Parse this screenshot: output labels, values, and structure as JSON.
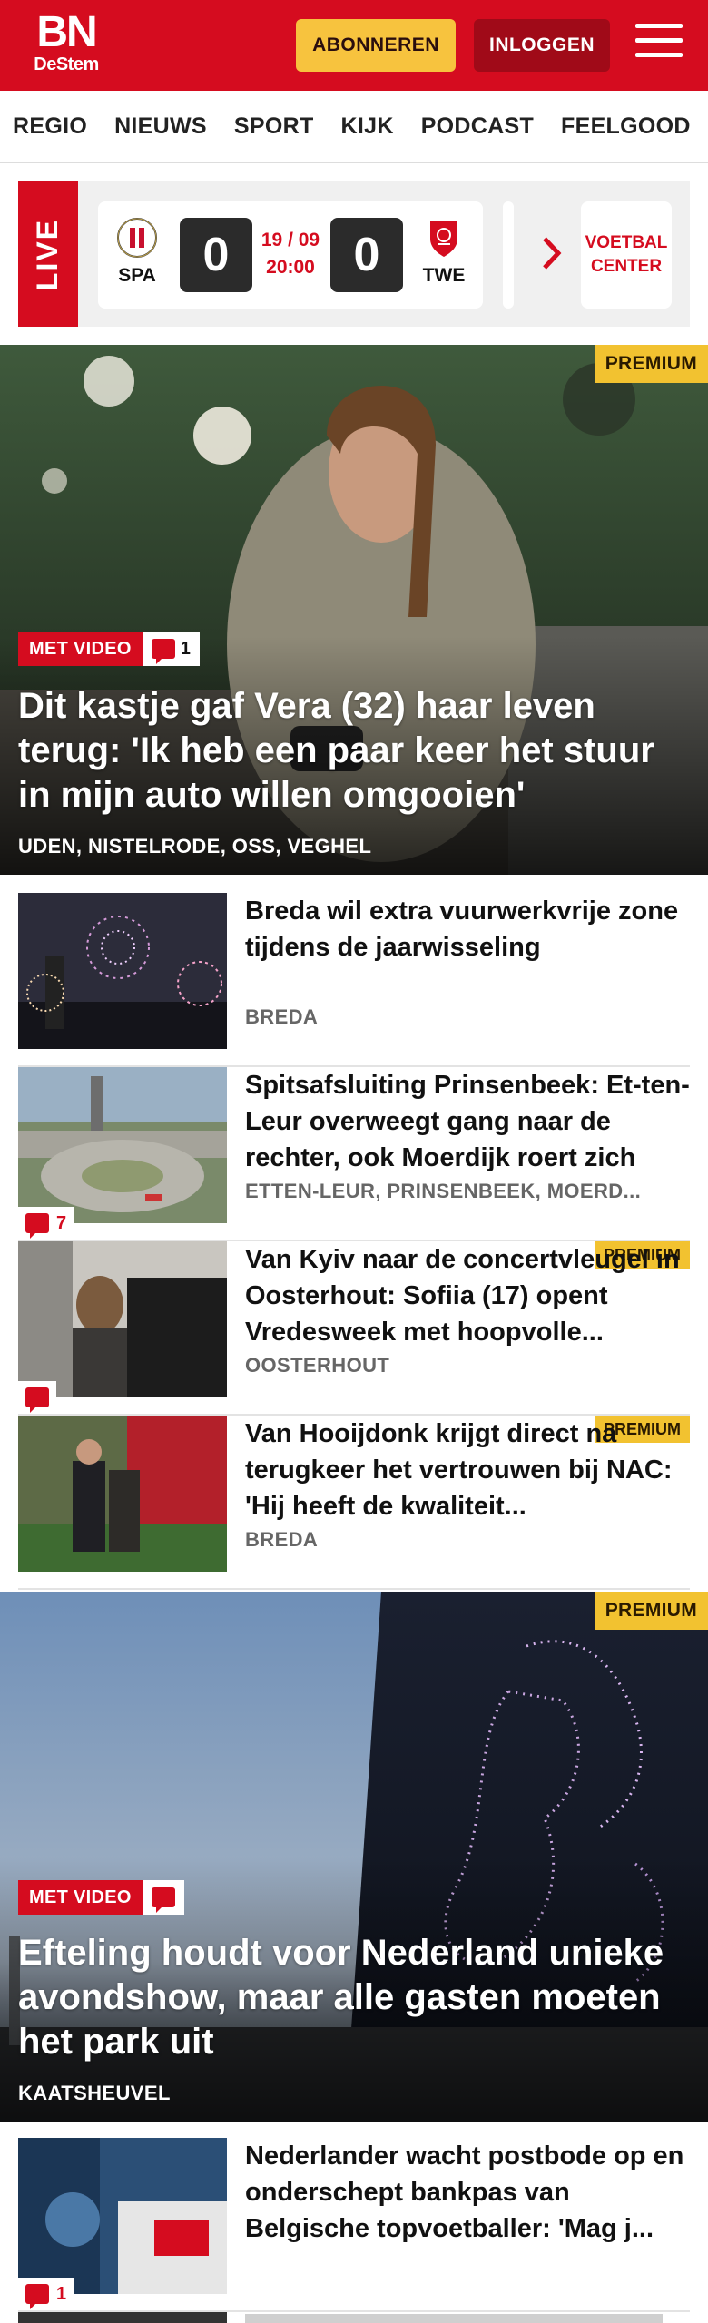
{
  "header": {
    "logo_top": "BN",
    "logo_bottom": "DeStem",
    "subscribe_label": "ABONNEREN",
    "login_label": "INLOGGEN"
  },
  "nav": {
    "items": [
      "REGIO",
      "NIEUWS",
      "SPORT",
      "KIJK",
      "PODCAST",
      "FEELGOOD"
    ]
  },
  "live": {
    "label": "LIVE",
    "match": {
      "home": "SPA",
      "away": "TWE",
      "home_score": "0",
      "away_score": "0",
      "date": "19 / 09",
      "time": "20:00"
    },
    "voetbal_center": "VOETBAL CENTER"
  },
  "hero1": {
    "premium": "PREMIUM",
    "video_label": "MET VIDEO",
    "comments": "1",
    "title": "Dit kastje gaf Vera (32) haar leven terug: 'Ik heb een paar keer het stuur in mijn auto willen omgooien'",
    "location": "UDEN, NISTELRODE, OSS, VEGHEL"
  },
  "articles": [
    {
      "title": "Breda wil extra vuurwerkvrije zone tijdens de jaarwisseling",
      "location": "BREDA",
      "comments": "",
      "premium": ""
    },
    {
      "title": "Spitsafsluiting Prinsenbeek: Et-ten-Leur overweegt gang naar de rechter, ook Moerdijk roert zich",
      "location": "ETTEN-LEUR, PRINSENBEEK, MOERD...",
      "comments": "7",
      "premium": ""
    },
    {
      "title": "Van Kyiv naar de concertvleugel in Oosterhout: Sofiia (17) opent Vredesweek met hoopvolle...",
      "location": "OOSTERHOUT",
      "comments": "",
      "premium": "PREMIUM"
    },
    {
      "title": "Van Hooijdonk krijgt direct na terugkeer het vertrouwen bij NAC: 'Hij heeft de kwaliteit...",
      "location": "BREDA",
      "comments": "",
      "premium": "PREMIUM"
    }
  ],
  "hero2": {
    "premium": "PREMIUM",
    "video_label": "MET VIDEO",
    "title": "Efteling houdt voor Nederland unieke avondshow, maar alle gasten moeten het park uit",
    "location": "KAATSHEUVEL"
  },
  "article_last": {
    "title": "Nederlander wacht postbode op en onderschept bankpas van Belgische topvoetballer: 'Mag j...",
    "comments": "1"
  },
  "colors": {
    "brand_red": "#d50c1f",
    "premium_yellow": "#f2c230",
    "subscribe_yellow": "#f7c33e"
  }
}
